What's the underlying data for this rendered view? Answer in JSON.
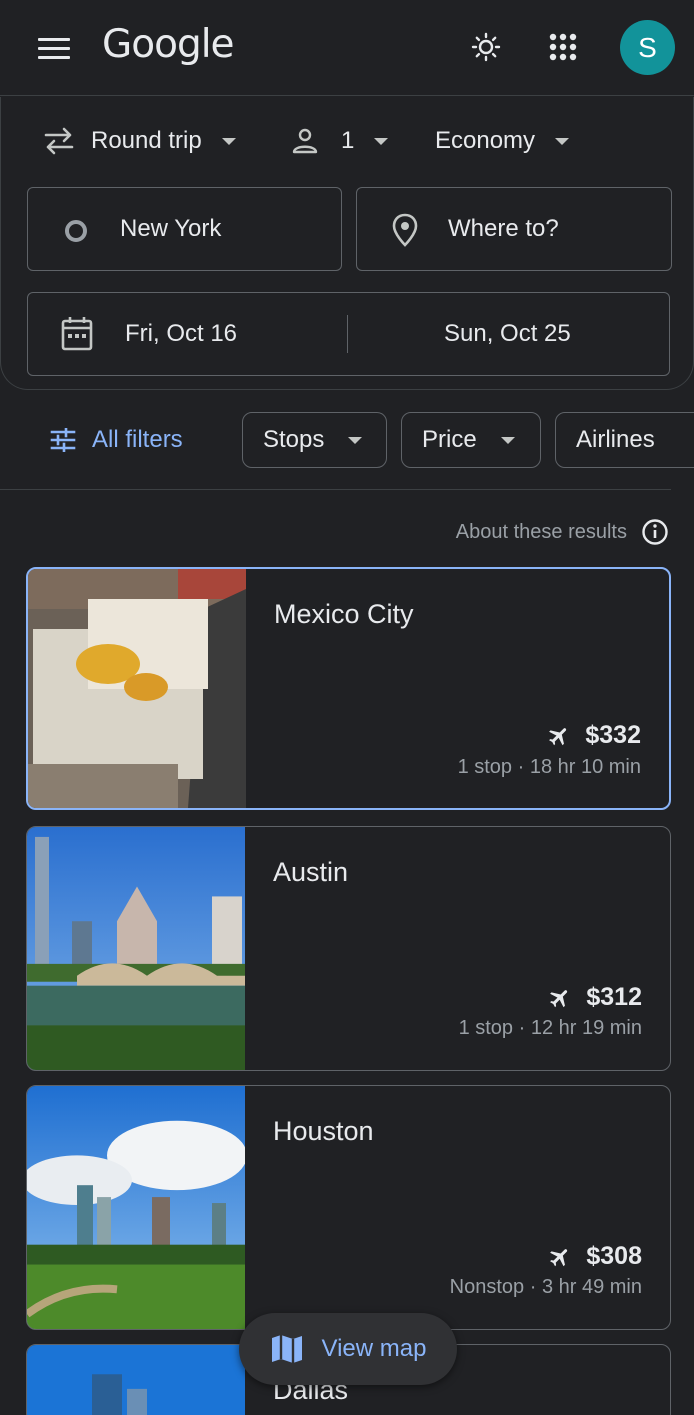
{
  "header": {
    "logo": "Google",
    "avatar_letter": "S"
  },
  "search": {
    "trip_type": "Round trip",
    "passengers": "1",
    "cabin_class": "Economy",
    "origin": "New York",
    "destination_placeholder": "Where to?",
    "departure_date": "Fri, Oct 16",
    "return_date": "Sun, Oct 25"
  },
  "filters": {
    "all_filters": "All filters",
    "chips": [
      "Stops",
      "Price",
      "Airlines"
    ]
  },
  "about_results": "About these results",
  "results": [
    {
      "city": "Mexico City",
      "price": "$332",
      "stops": "1 stop",
      "duration": "18 hr 10 min",
      "selected": true
    },
    {
      "city": "Austin",
      "price": "$312",
      "stops": "1 stop",
      "duration": "12 hr 19 min"
    },
    {
      "city": "Houston",
      "price": "$308",
      "stops": "Nonstop",
      "duration": "3 hr 49 min"
    },
    {
      "city": "Dallas"
    }
  ],
  "view_map": "View map",
  "colors": {
    "background": "#202124",
    "accent": "#8ab4f8",
    "avatar": "#12939a",
    "border": "#5f6368"
  }
}
